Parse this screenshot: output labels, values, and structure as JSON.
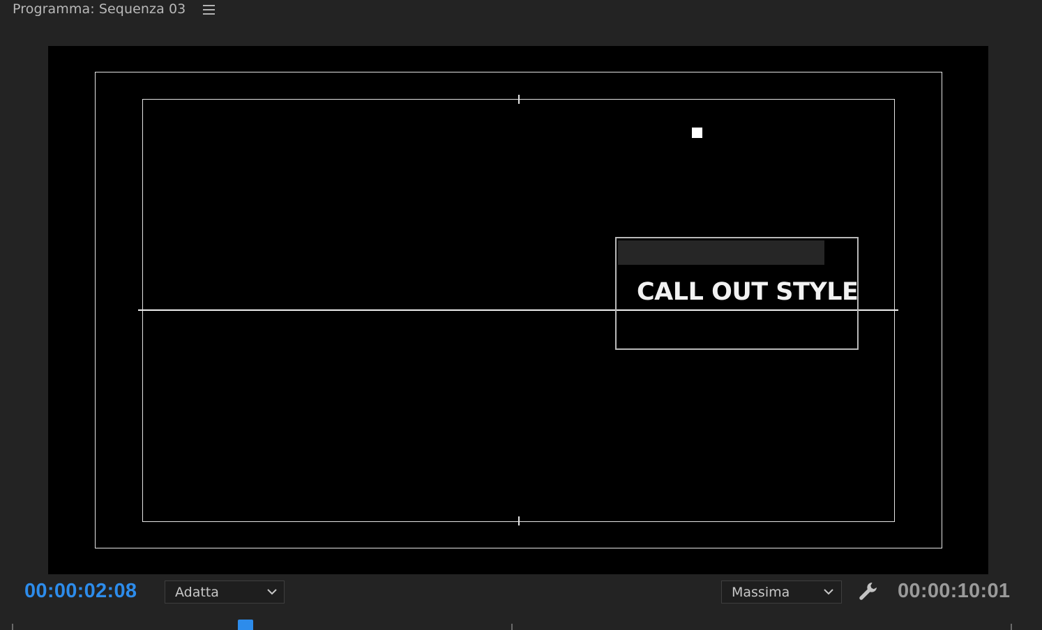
{
  "header": {
    "title": "Programma: Sequenza 03",
    "menu_icon": "hamburger-menu-icon"
  },
  "monitor": {
    "callout_text": "CALL OUT STYLE"
  },
  "controls": {
    "current_timecode": "00:00:02:08",
    "fit_label": "Adatta",
    "quality_label": "Massima",
    "duration_timecode": "00:00:10:01",
    "settings_icon": "wrench-icon"
  },
  "colors": {
    "accent": "#2d8ceb",
    "panel_bg": "#232323",
    "monitor_bg": "#000000"
  }
}
